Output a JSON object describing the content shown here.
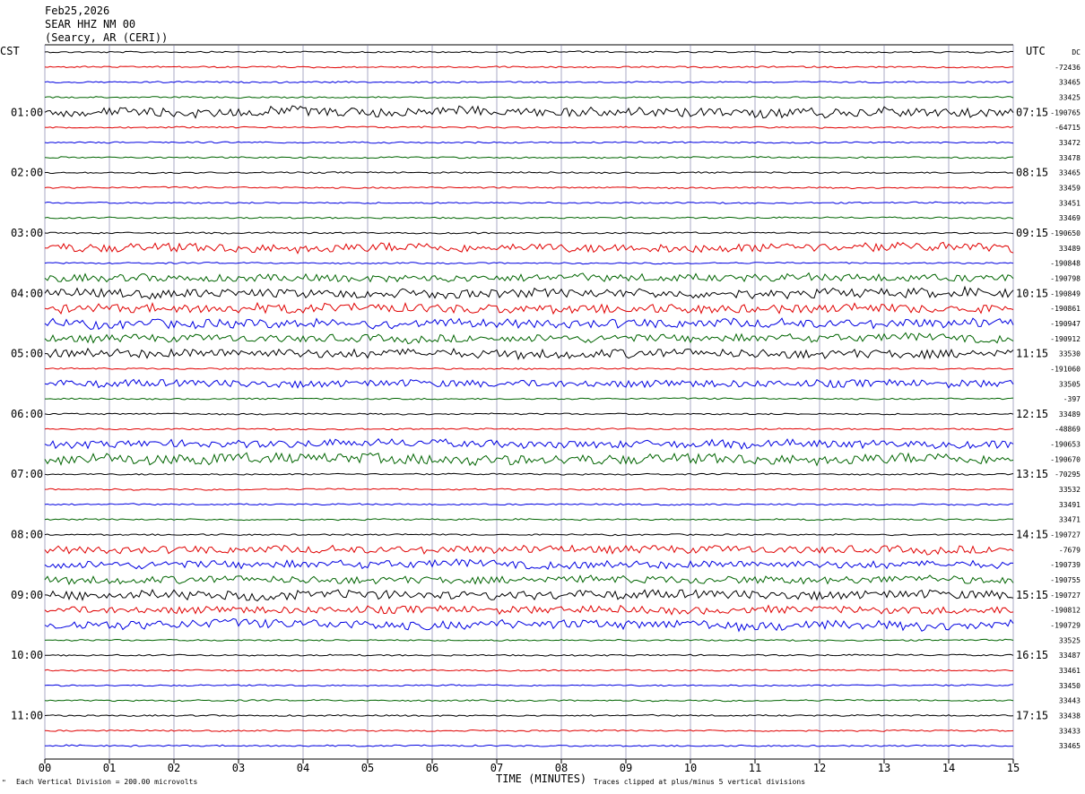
{
  "header": {
    "date": "Feb25,2026",
    "station": "SEAR HHZ NM 00",
    "location": "(Searcy, AR (CERI))"
  },
  "left_label": "CST",
  "right_label": "UTC",
  "footer": {
    "scale_note": "Each Vertical Division =  200.00 microvolts",
    "xlabel": "TIME (MINUTES)",
    "clip_note": "Traces clipped at plus/minus 5 vertical divisions"
  },
  "colors": {
    "black": "#000000",
    "red": "#e00000",
    "blue": "#0000e0",
    "green": "#006400",
    "grid": "#7070a0"
  },
  "chart_data": {
    "type": "line",
    "xlabel": "TIME (MINUTES)",
    "xlim": [
      0,
      15
    ],
    "x_ticks": [
      "00",
      "01",
      "02",
      "03",
      "04",
      "05",
      "06",
      "07",
      "08",
      "09",
      "10",
      "11",
      "12",
      "13",
      "14",
      "15"
    ],
    "cst_labels": [
      "01:00",
      "02:00",
      "03:00",
      "04:00",
      "05:00",
      "06:00",
      "07:00",
      "08:00",
      "09:00",
      "10:00",
      "11:00"
    ],
    "utc_labels": [
      "07:15",
      "08:15",
      "09:15",
      "10:15",
      "11:15",
      "12:15",
      "13:15",
      "14:15",
      "15:15",
      "16:15",
      "17:15"
    ],
    "trace_offsets": [
      "DC",
      "-72436",
      "33465",
      "33425",
      "-190765",
      "-64715",
      "33472",
      "33478",
      "33465",
      "33459",
      "33451",
      "33469",
      "-190650",
      "33489",
      "-190848",
      "-190798",
      "-190849",
      "-190861",
      "-190947",
      "-190912",
      "33530",
      "-191060",
      "33505",
      "-397",
      "33489",
      "-48869",
      "-190653",
      "-190670",
      "-70295",
      "33532",
      "33491",
      "33471",
      "-190727",
      "-7679",
      "-190739",
      "-190755",
      "-190727",
      "-190812",
      "-190729",
      "33525",
      "33487",
      "33461",
      "33450",
      "33443",
      "33438",
      "33433",
      "33465"
    ],
    "trace_colors": [
      "black",
      "red",
      "blue",
      "green",
      "black",
      "red",
      "blue",
      "green",
      "black",
      "red",
      "blue",
      "green",
      "black",
      "red",
      "blue",
      "green",
      "black",
      "red",
      "blue",
      "green",
      "black",
      "red",
      "blue",
      "green",
      "black",
      "red",
      "blue",
      "green",
      "black",
      "red",
      "blue",
      "green",
      "black",
      "red",
      "blue",
      "green",
      "black",
      "red",
      "blue",
      "green",
      "black",
      "red",
      "blue",
      "green",
      "black",
      "red",
      "blue",
      "green"
    ],
    "trace_amplitude": [
      1,
      0,
      1,
      1,
      6,
      0,
      1,
      1,
      1,
      1,
      1,
      1,
      1,
      6,
      1,
      5,
      6,
      6,
      6,
      5,
      6,
      1,
      5,
      1,
      1,
      1,
      5,
      7,
      1,
      1,
      1,
      1,
      1,
      5,
      5,
      5,
      6,
      5,
      6,
      1,
      1,
      1,
      1,
      1,
      1,
      1,
      1,
      1
    ]
  }
}
